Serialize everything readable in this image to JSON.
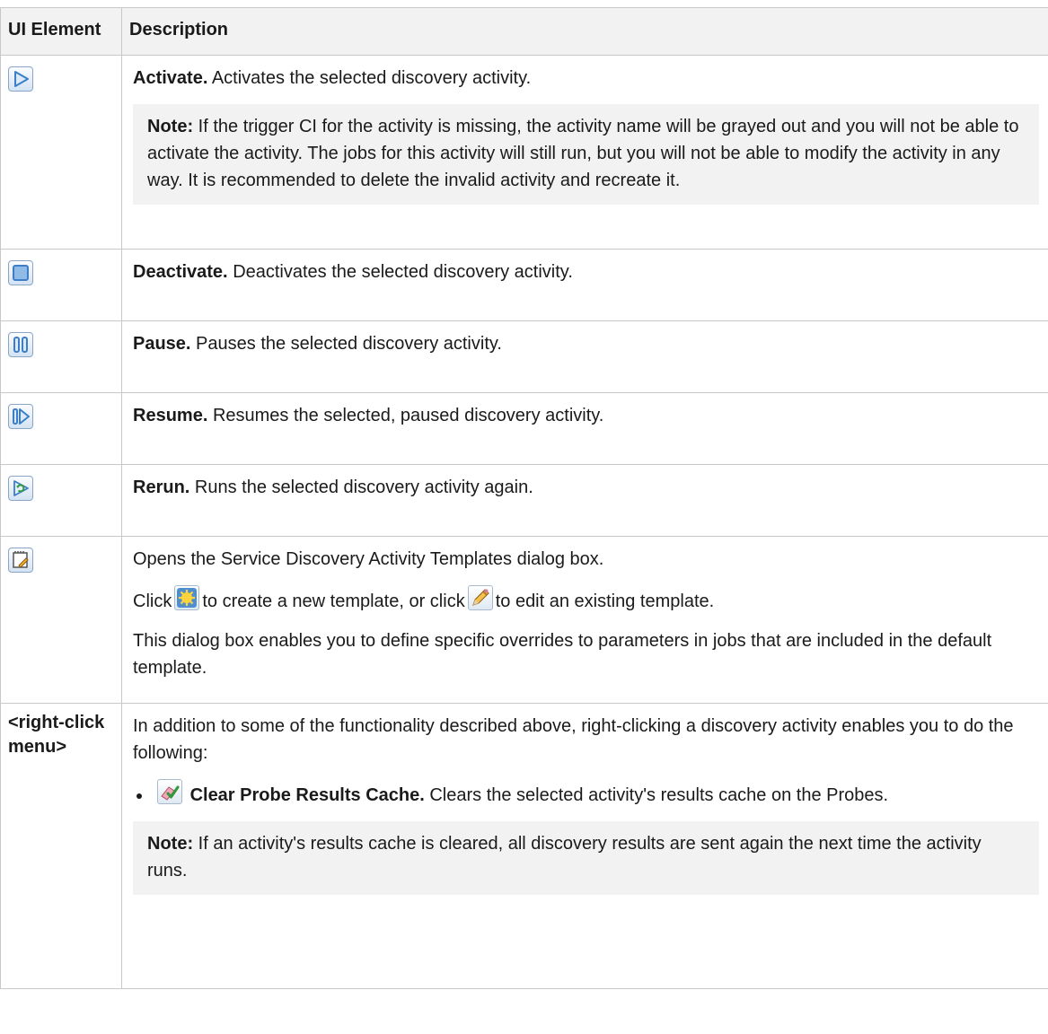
{
  "header": {
    "col1": "UI Element",
    "col2": "Description"
  },
  "rows": [
    {
      "icon": "activate-icon",
      "title": "Activate.",
      "text": "Activates the selected discovery activity.",
      "note_label": "Note:",
      "note_text": "If the trigger CI for the activity is missing, the activity name will be grayed out and you will not be able to activate the activity. The jobs for this activity will still run, but you will not be able to modify the activity in any way. It is recommended to delete the invalid activity and recreate it."
    },
    {
      "icon": "deactivate-icon",
      "title": "Deactivate.",
      "text": "Deactivates the selected discovery activity."
    },
    {
      "icon": "pause-icon",
      "title": "Pause.",
      "text": "Pauses the selected discovery activity."
    },
    {
      "icon": "resume-icon",
      "title": "Resume.",
      "text": "Resumes the selected, paused discovery activity."
    },
    {
      "icon": "rerun-icon",
      "title": "Rerun.",
      "text": "Runs the selected discovery activity again."
    },
    {
      "icon": "templates-icon",
      "line1": "Opens the Service Discovery Activity Templates dialog box.",
      "click_a": "Click",
      "click_b": "to create a new template, or click",
      "click_c": "to edit an existing template.",
      "line3": "This dialog box enables you to define specific overrides to parameters in jobs that are included in the default template."
    },
    {
      "label": "<right-click menu>",
      "intro": "In addition to some of the functionality described above, right-clicking a discovery activity enables you to do the following:",
      "bullet_title": "Clear Probe Results Cache.",
      "bullet_text": "Clears the selected activity's results cache on the Probes.",
      "note_label": "Note:",
      "note_text": "If an activity's results cache is cleared, all discovery results are sent again the next time the activity runs."
    }
  ],
  "colors": {
    "border": "#c8c8c8",
    "header_bg": "#f2f2f2",
    "note_bg": "#f2f2f2",
    "icon_blue": "#3d7fc6"
  }
}
